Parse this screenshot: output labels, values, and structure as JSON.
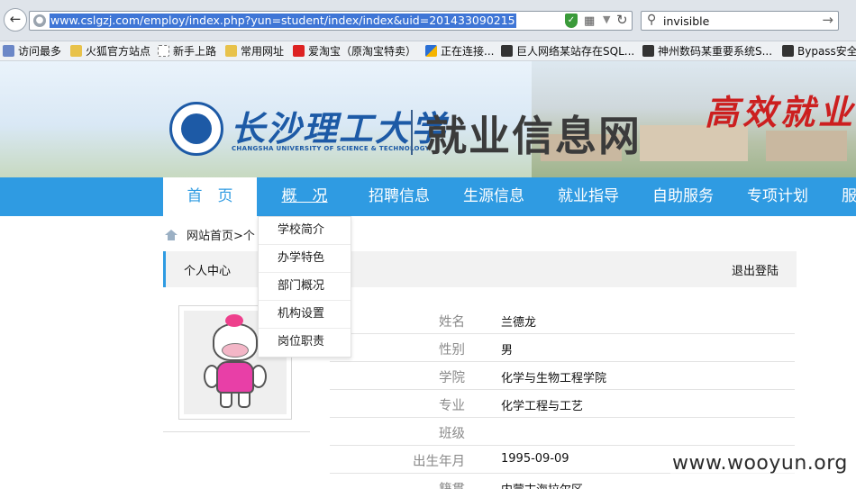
{
  "browser": {
    "url": "www.cslgzj.com/employ/index.php?yun=student/index/index&uid=201433090215",
    "search_value": "invisible",
    "bookmarks": [
      {
        "label": "访问最多",
        "icon": "gear"
      },
      {
        "label": "火狐官方站点",
        "icon": "folder"
      },
      {
        "label": "新手上路",
        "icon": "page"
      },
      {
        "label": "常用网址",
        "icon": "folder"
      },
      {
        "label": "爱淘宝（原淘宝特卖）",
        "icon": "taobao"
      },
      {
        "label": "正在连接...",
        "icon": "conn"
      },
      {
        "label": "巨人网络某站存在SQL...",
        "icon": "dark"
      },
      {
        "label": "神州数码某重要系统S...",
        "icon": "dark"
      },
      {
        "label": "Bypass安全",
        "icon": "dark"
      }
    ]
  },
  "header": {
    "school_cn": "长沙理工大学",
    "school_en": "CHANGSHA UNIVERSITY OF SCIENCE & TECHNOLOGY",
    "site_title": "就业信息网",
    "slogan": "高效就业"
  },
  "nav": {
    "items": [
      "首　页",
      "概　况",
      "招聘信息",
      "生源信息",
      "就业指导",
      "自助服务",
      "专项计划",
      "服"
    ],
    "dropdown": [
      "学校简介",
      "办学特色",
      "部门概况",
      "机构设置",
      "岗位职责"
    ]
  },
  "breadcrumb": "网站首页>个",
  "panel": {
    "title": "个人中心",
    "logout": "退出登陆"
  },
  "profile": [
    {
      "label": "姓名",
      "value": "兰德龙"
    },
    {
      "label": "性别",
      "value": "男"
    },
    {
      "label": "学院",
      "value": "化学与生物工程学院"
    },
    {
      "label": "专业",
      "value": "化学工程与工艺"
    },
    {
      "label": "班级",
      "value": ""
    },
    {
      "label": "出生年月",
      "value": "1995-09-09"
    },
    {
      "label": "籍贯",
      "value": "内蒙古海拉尔区"
    }
  ],
  "watermark": "www.wooyun.org"
}
